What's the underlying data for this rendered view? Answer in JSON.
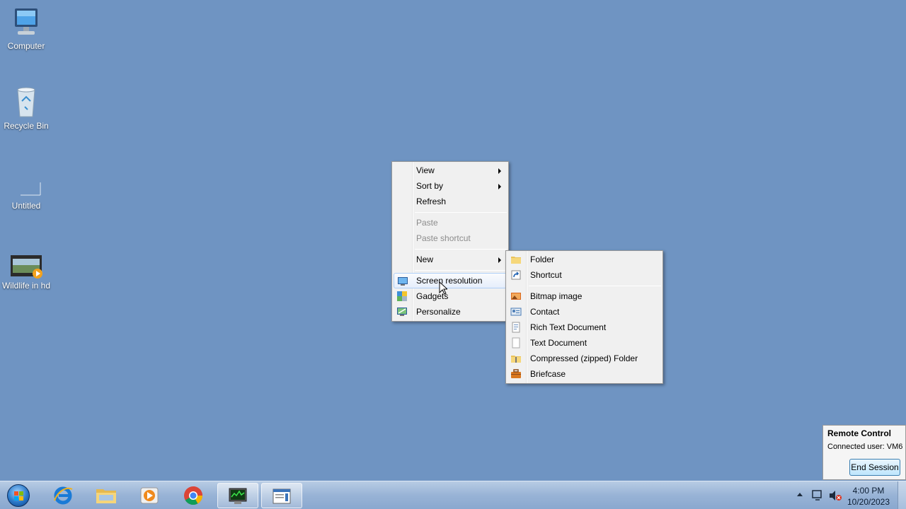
{
  "desktop": {
    "icons": [
      {
        "label": "Computer"
      },
      {
        "label": "Recycle Bin"
      },
      {
        "label": "Untitled"
      },
      {
        "label": "Wildlife in hd"
      }
    ]
  },
  "context_menu": {
    "items": [
      {
        "label": "View",
        "submenu": true
      },
      {
        "label": "Sort by",
        "submenu": true
      },
      {
        "label": "Refresh"
      },
      {
        "label": "Paste",
        "disabled": true
      },
      {
        "label": "Paste shortcut",
        "disabled": true
      },
      {
        "label": "New",
        "submenu": true
      },
      {
        "label": "Screen resolution",
        "icon": "screen-resolution-icon"
      },
      {
        "label": "Gadgets",
        "icon": "gadgets-icon"
      },
      {
        "label": "Personalize",
        "icon": "personalize-icon"
      }
    ]
  },
  "new_submenu": {
    "items": [
      {
        "label": "Folder",
        "icon": "folder-icon"
      },
      {
        "label": "Shortcut",
        "icon": "shortcut-icon"
      },
      {
        "label": "Bitmap image",
        "icon": "bitmap-icon"
      },
      {
        "label": "Contact",
        "icon": "contact-icon"
      },
      {
        "label": "Rich Text Document",
        "icon": "rich-text-icon"
      },
      {
        "label": "Text Document",
        "icon": "text-document-icon"
      },
      {
        "label": "Compressed (zipped) Folder",
        "icon": "zip-folder-icon"
      },
      {
        "label": "Briefcase",
        "icon": "briefcase-icon"
      }
    ]
  },
  "taskbar": {
    "apps": [
      {
        "name": "internet-explorer-icon"
      },
      {
        "name": "file-explorer-icon"
      },
      {
        "name": "media-player-icon"
      },
      {
        "name": "chrome-icon"
      },
      {
        "name": "task-manager-icon"
      },
      {
        "name": "notepad-window-icon"
      }
    ],
    "clock_time": "4:00 PM",
    "clock_date": "10/20/2023"
  },
  "remote_control": {
    "title": "Remote Control",
    "connected": "Connected user: VM6",
    "end_session": "End Session"
  },
  "colors": {
    "desktop": "#6f94c2",
    "menu_bg": "#f0f0f0",
    "hover_border": "#aecff7"
  }
}
